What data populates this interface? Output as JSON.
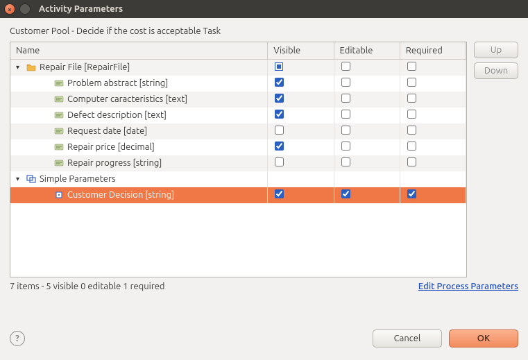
{
  "window": {
    "title": "Activity Parameters"
  },
  "subtitle": "Customer Pool  - Decide if the cost is acceptable Task",
  "columns": {
    "name": "Name",
    "visible": "Visible",
    "editable": "Editable",
    "required": "Required"
  },
  "rows": [
    {
      "type": "parent",
      "icon": "folder",
      "label": "Repair File [RepairFile]",
      "visible": "filled",
      "editable": false,
      "required": false,
      "depth": 0
    },
    {
      "type": "child",
      "icon": "field",
      "label": "Problem abstract [string]",
      "visible": true,
      "editable": false,
      "required": false,
      "depth": 1
    },
    {
      "type": "child",
      "icon": "field",
      "label": "Computer caracteristics [text]",
      "visible": true,
      "editable": false,
      "required": false,
      "depth": 1
    },
    {
      "type": "child",
      "icon": "field",
      "label": "Defect description [text]",
      "visible": true,
      "editable": false,
      "required": false,
      "depth": 1
    },
    {
      "type": "child",
      "icon": "field",
      "label": "Request date [date]",
      "visible": false,
      "editable": false,
      "required": false,
      "depth": 1
    },
    {
      "type": "child",
      "icon": "field",
      "label": "Repair price [decimal]",
      "visible": true,
      "editable": false,
      "required": false,
      "depth": 1
    },
    {
      "type": "child",
      "icon": "field",
      "label": "Repair progress [string]",
      "visible": false,
      "editable": false,
      "required": false,
      "depth": 1
    },
    {
      "type": "parent",
      "icon": "group",
      "label": "Simple Parameters",
      "depth": 0
    },
    {
      "type": "child",
      "icon": "item",
      "label": "Customer Decision [string]",
      "visible": true,
      "editable": true,
      "required": true,
      "depth": 1,
      "selected": true
    }
  ],
  "side": {
    "up": "Up",
    "down": "Down"
  },
  "summary": "7 items - 5 visible  0 editable  1 required",
  "edit_link": "Edit Process Parameters",
  "footer": {
    "cancel": "Cancel",
    "ok": "OK"
  },
  "chart_data": {
    "type": "table",
    "columns": [
      "Name",
      "Visible",
      "Editable",
      "Required"
    ],
    "rows": [
      [
        "Repair File [RepairFile]",
        "filled",
        false,
        false
      ],
      [
        "Problem abstract [string]",
        true,
        false,
        false
      ],
      [
        "Computer caracteristics [text]",
        true,
        false,
        false
      ],
      [
        "Defect description [text]",
        true,
        false,
        false
      ],
      [
        "Request date [date]",
        false,
        false,
        false
      ],
      [
        "Repair price [decimal]",
        true,
        false,
        false
      ],
      [
        "Repair progress [string]",
        false,
        false,
        false
      ],
      [
        "Simple Parameters",
        null,
        null,
        null
      ],
      [
        "Customer Decision [string]",
        true,
        true,
        true
      ]
    ]
  }
}
